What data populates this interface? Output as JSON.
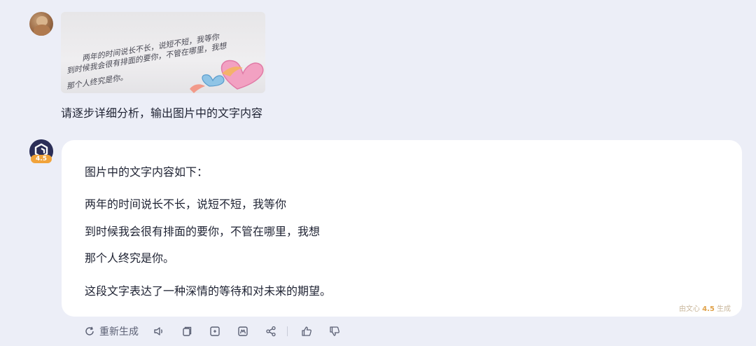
{
  "user": {
    "question": "请逐步详细分析，输出图片中的文字内容",
    "photo_lines": [
      "两年的时间说长不长，说短不短，我等你",
      "到时候我会很有排面的要你，不管在哪里，我想",
      "那个人终究是你。"
    ]
  },
  "assistant": {
    "badge": "4.5",
    "intro": "图片中的文字内容如下：",
    "lines": [
      "两年的时间说长不长，说短不短，我等你",
      "到时候我会很有排面的要你，不管在哪里，我想",
      "那个人终究是你。"
    ],
    "summary": "这段文字表达了一种深情的等待和对未来的期望。",
    "watermark_prefix": "由文心",
    "watermark_version": "4.5",
    "watermark_suffix": "生成"
  },
  "toolbar": {
    "regenerate_label": "重新生成",
    "icons": [
      "refresh-icon",
      "speaker-icon",
      "copy-icon",
      "export-icon",
      "mindmap-icon",
      "share-icon",
      "thumbs-up-icon",
      "thumbs-down-icon"
    ]
  }
}
